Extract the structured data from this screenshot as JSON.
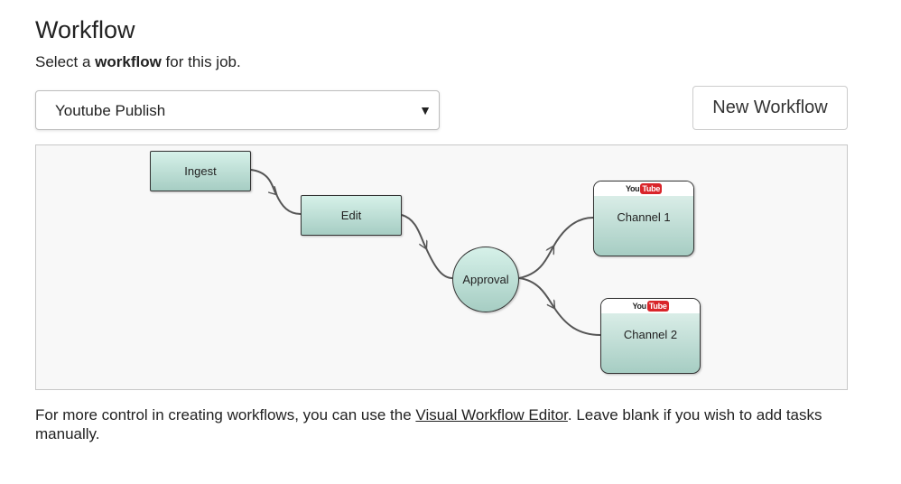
{
  "header": {
    "title": "Workflow",
    "subtitle_prefix": "Select a ",
    "subtitle_bold": "workflow",
    "subtitle_suffix": " for this job."
  },
  "workflow_select": {
    "selected": "Youtube Publish",
    "caret": "▼"
  },
  "new_workflow_button": {
    "label": "New Workflow"
  },
  "diagram": {
    "nodes": {
      "ingest": "Ingest",
      "edit": "Edit",
      "approval": "Approval",
      "channel1": "Channel 1",
      "channel2": "Channel 2"
    },
    "logo": {
      "you": "You",
      "tube": "Tube"
    },
    "colors": {
      "node_fill_top": "#d6f1e9",
      "node_fill_bottom": "#a6cdc3",
      "youtube_red": "#d9252a",
      "connector": "#555555",
      "canvas_bg": "#f8f8f8"
    }
  },
  "footer": {
    "text_before": "For more control in creating workflows, you can use the ",
    "link": "Visual Workflow Editor",
    "text_after": ". Leave blank if you wish to add tasks manually."
  }
}
